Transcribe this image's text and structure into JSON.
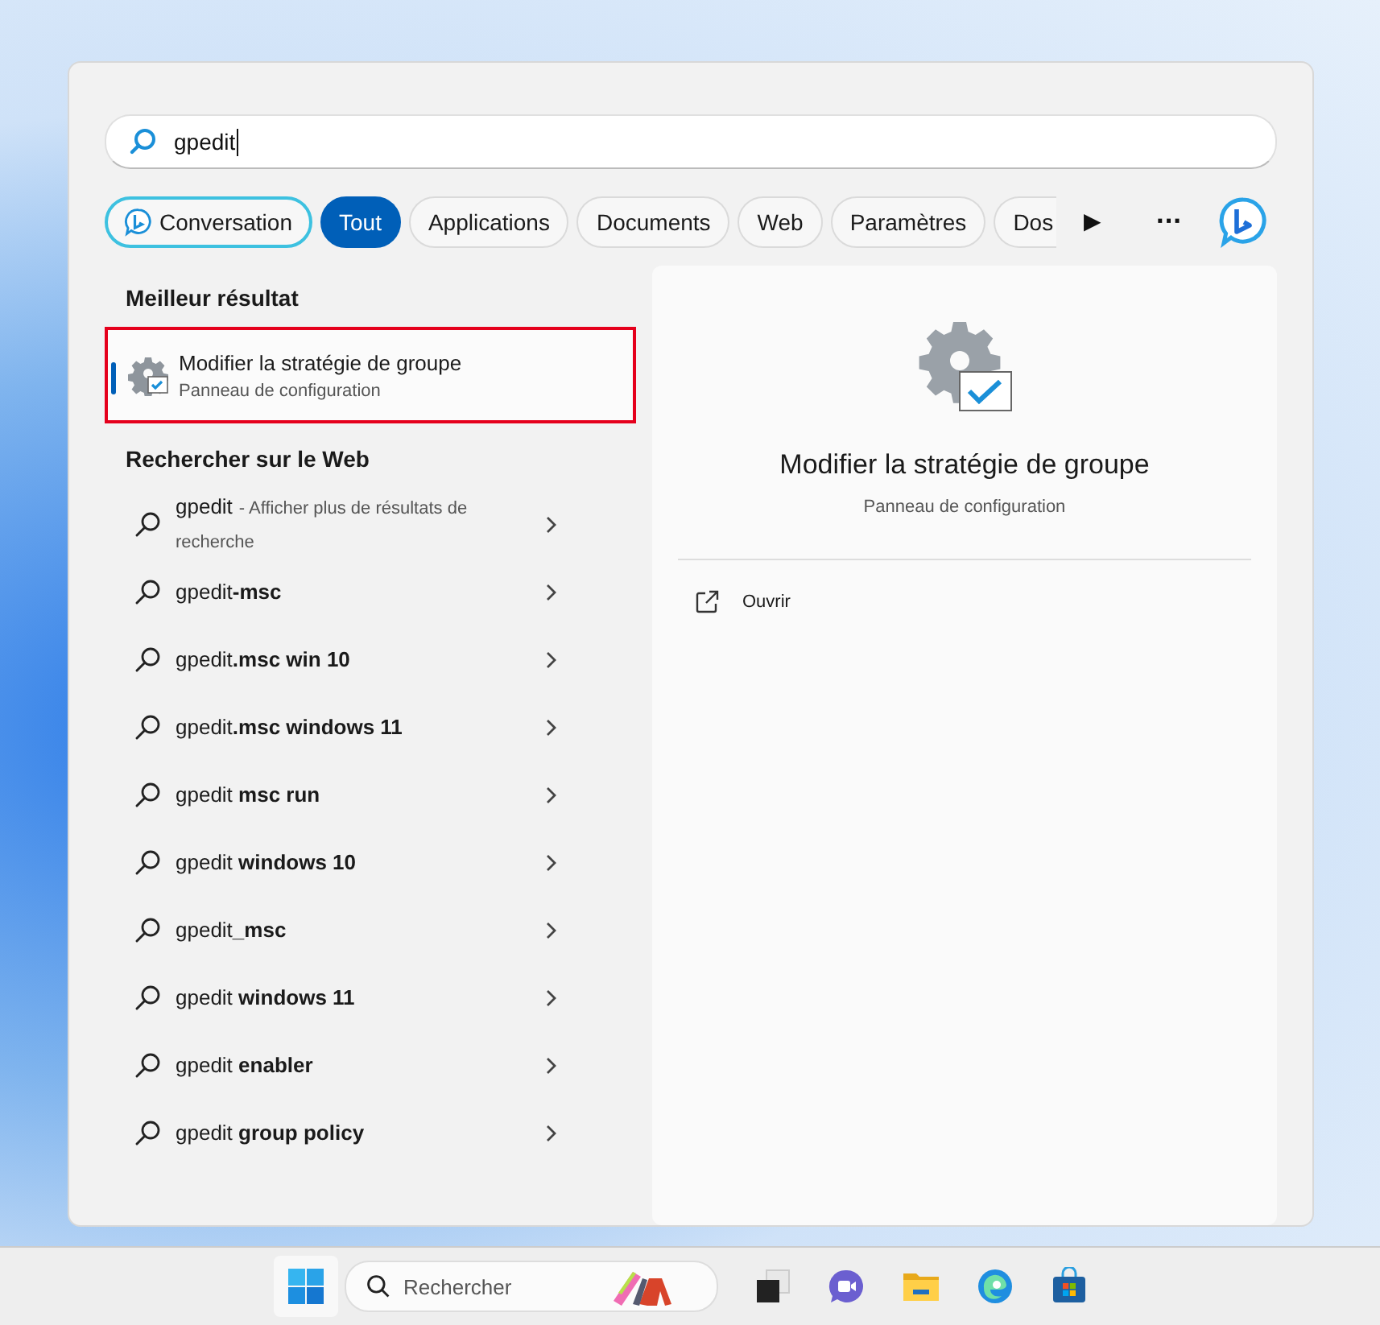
{
  "search": {
    "value": "gpedit"
  },
  "filters": [
    {
      "label": "Conversation",
      "kind": "chat",
      "selected": false
    },
    {
      "label": "Tout",
      "kind": "tab",
      "selected": true
    },
    {
      "label": "Applications",
      "kind": "tab",
      "selected": false
    },
    {
      "label": "Documents",
      "kind": "tab",
      "selected": false
    },
    {
      "label": "Web",
      "kind": "tab",
      "selected": false
    },
    {
      "label": "Paramètres",
      "kind": "tab",
      "selected": false
    },
    {
      "label": "Dos",
      "kind": "tab",
      "selected": false
    }
  ],
  "more_tabs": "▶",
  "more_menu": "···",
  "best_heading": "Meilleur résultat",
  "best_result": {
    "title": "Modifier la stratégie de groupe",
    "subtitle": "Panneau de configuration",
    "selected": true,
    "highlighted": true
  },
  "web_heading": "Rechercher sur le Web",
  "web_results": [
    {
      "text": "gpedit",
      "hint": "- Afficher plus de résultats de recherche"
    },
    {
      "text": "gpedit**-msc**"
    },
    {
      "text": "gpedit**.msc win 10**"
    },
    {
      "text": "gpedit**.msc windows 11**"
    },
    {
      "text": "gpedit **msc run**"
    },
    {
      "text": "gpedit **windows 10**"
    },
    {
      "text": "gpedit**_msc**"
    },
    {
      "text": "gpedit **windows 11**"
    },
    {
      "text": "gpedit **enabler**"
    },
    {
      "text": "gpedit **group policy**"
    }
  ],
  "detail": {
    "title": "Modifier la stratégie de groupe",
    "subtitle": "Panneau de configuration",
    "actions": [
      "Ouvrir"
    ]
  },
  "taskbar": {
    "search_placeholder": "Rechercher"
  }
}
